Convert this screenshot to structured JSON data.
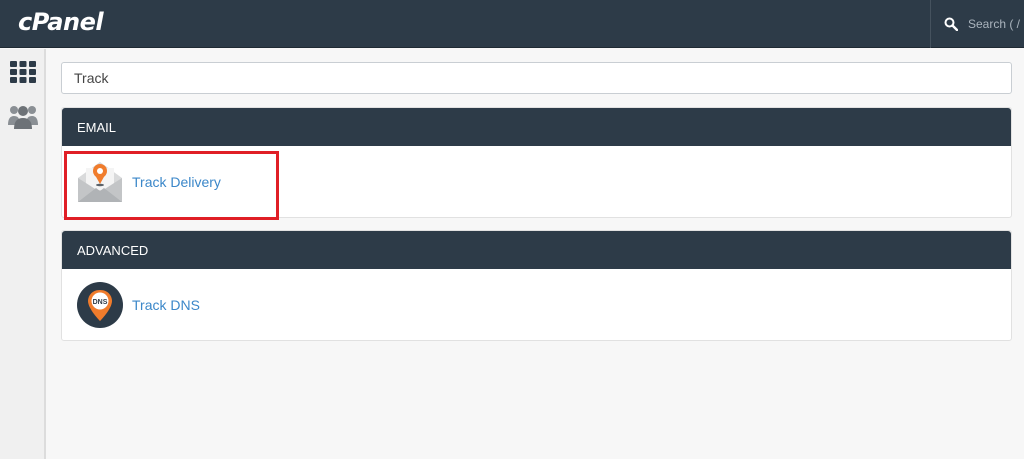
{
  "header": {
    "logo": "cPanel",
    "search_placeholder": "Search ( /"
  },
  "sidebar": {
    "items": [
      {
        "icon": "grid-icon"
      },
      {
        "icon": "users-icon"
      }
    ]
  },
  "search": {
    "value": "Track"
  },
  "sections": [
    {
      "title": "EMAIL",
      "items": [
        {
          "label": "Track Delivery",
          "icon": "envelope-pin-icon"
        }
      ]
    },
    {
      "title": "ADVANCED",
      "items": [
        {
          "label": "Track DNS",
          "icon": "dns-pin-icon",
          "badge": "DNS"
        }
      ]
    }
  ],
  "colors": {
    "header_bg": "#2d3b48",
    "link": "#3b87c9",
    "highlight": "#e01f26",
    "accent_orange": "#f07c2c"
  }
}
